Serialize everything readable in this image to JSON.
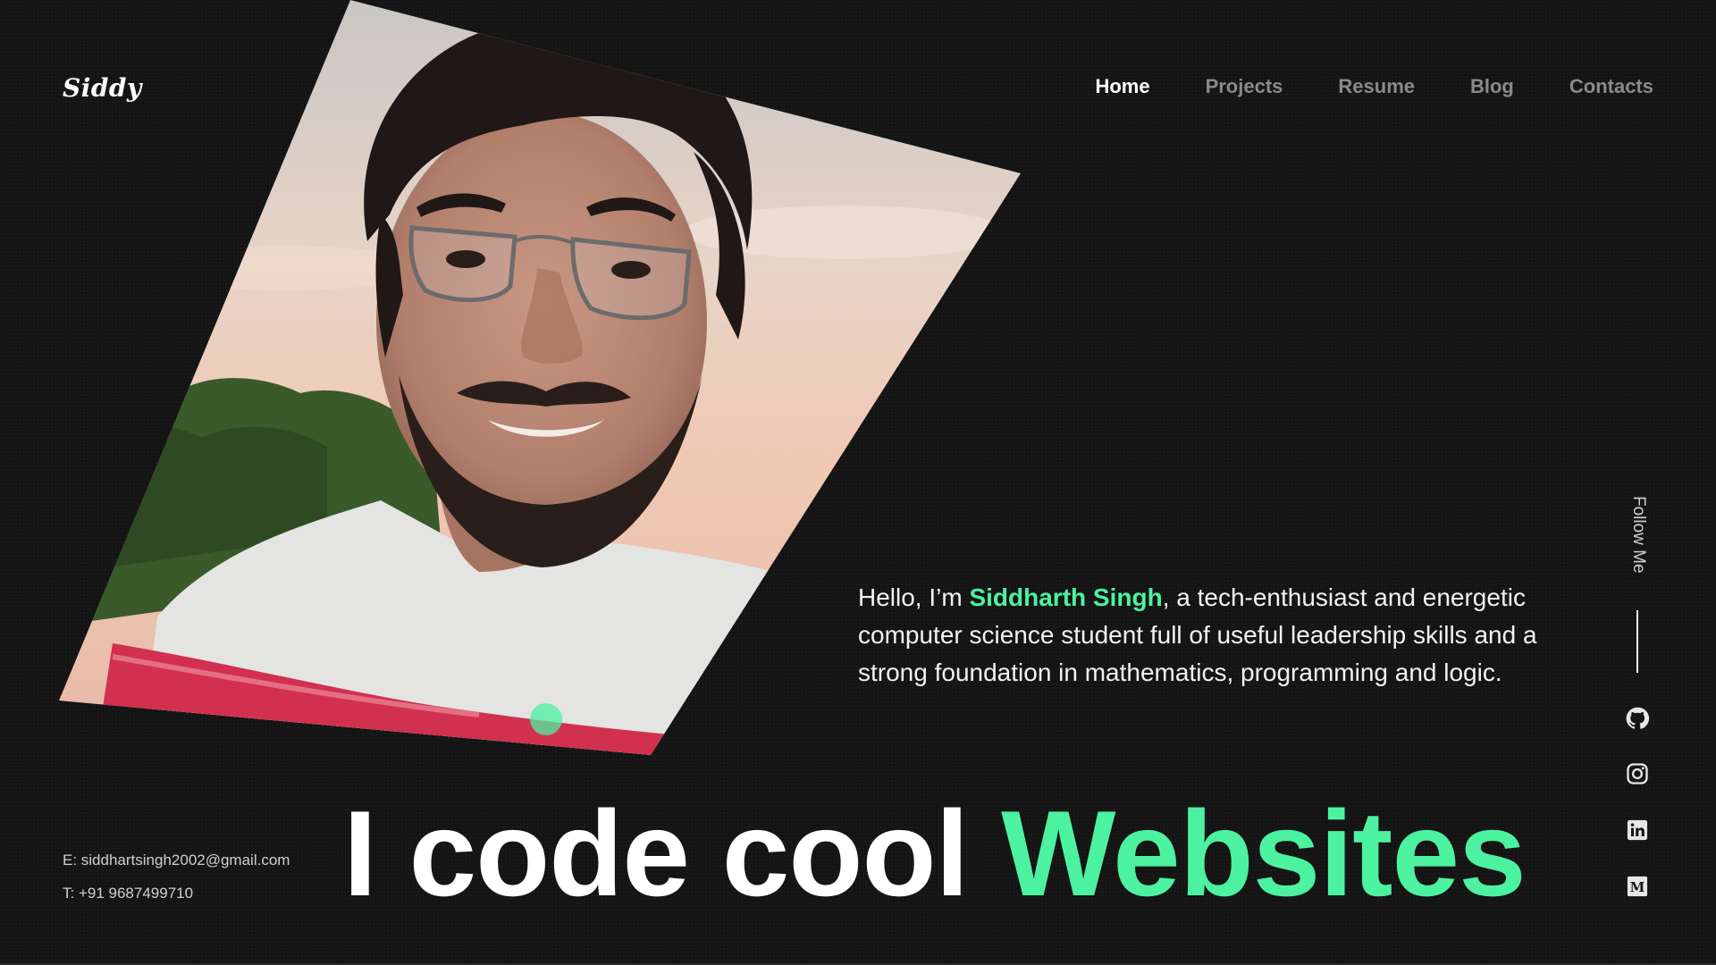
{
  "header": {
    "logo": "Siddy",
    "nav": [
      {
        "label": "Home",
        "active": true
      },
      {
        "label": "Projects",
        "active": false
      },
      {
        "label": "Resume",
        "active": false
      },
      {
        "label": "Blog",
        "active": false
      },
      {
        "label": "Contacts",
        "active": false
      }
    ]
  },
  "hero": {
    "photo_alt": "portrait-photo",
    "intro": {
      "prefix": "Hello, I’m ",
      "name": "Siddharth Singh",
      "suffix": ", a tech-enthusiast and energetic computer science student full of useful leadership skills and a strong foundation in mathematics, programming and logic."
    },
    "headline": {
      "main": "I code cool ",
      "accent": "Websites"
    }
  },
  "contact": {
    "email": "E: siddhartsingh2002@gmail.com",
    "phone": "T: +91 9687499710"
  },
  "social": {
    "label": "Follow Me",
    "icons": [
      "github-icon",
      "instagram-icon",
      "linkedin-icon",
      "medium-icon"
    ]
  },
  "colors": {
    "background": "#141414",
    "accent": "#4cf2a0",
    "nav_inactive": "#8a8a8a",
    "text": "#ffffff"
  }
}
